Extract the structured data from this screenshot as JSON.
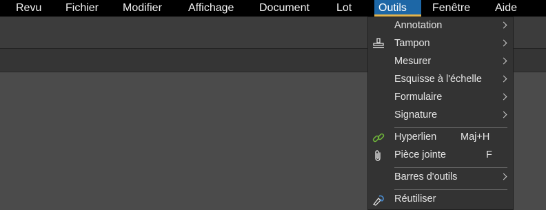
{
  "menubar": {
    "items": [
      "Revu",
      "Fichier",
      "Modifier",
      "Affichage",
      "Document",
      "Lot",
      "Outils",
      "Fenêtre",
      "Aide"
    ],
    "active": "Outils"
  },
  "outils_menu": {
    "items": [
      {
        "label": "Annotation",
        "submenu": true
      },
      {
        "label": "Tampon",
        "submenu": true,
        "icon": "stamp-icon"
      },
      {
        "label": "Mesurer",
        "submenu": true
      },
      {
        "label": "Esquisse à l'échelle",
        "submenu": true
      },
      {
        "label": "Formulaire",
        "submenu": true
      },
      {
        "label": "Signature",
        "submenu": true
      },
      {
        "label": "Hyperlien",
        "shortcut": "Maj+H",
        "icon": "link-icon"
      },
      {
        "label": "Pièce jointe",
        "shortcut": "F",
        "icon": "paperclip-icon"
      },
      {
        "label": "Barres d'outils",
        "submenu": true
      },
      {
        "label": "Réutiliser",
        "icon": "reuse-icon"
      }
    ]
  },
  "colors": {
    "menubar_bg": "#000000",
    "active_menu_bg": "#1d67a6",
    "active_underline": "#e3b34c",
    "menu_bg": "#333333",
    "link_icon": "#6fb33a"
  }
}
